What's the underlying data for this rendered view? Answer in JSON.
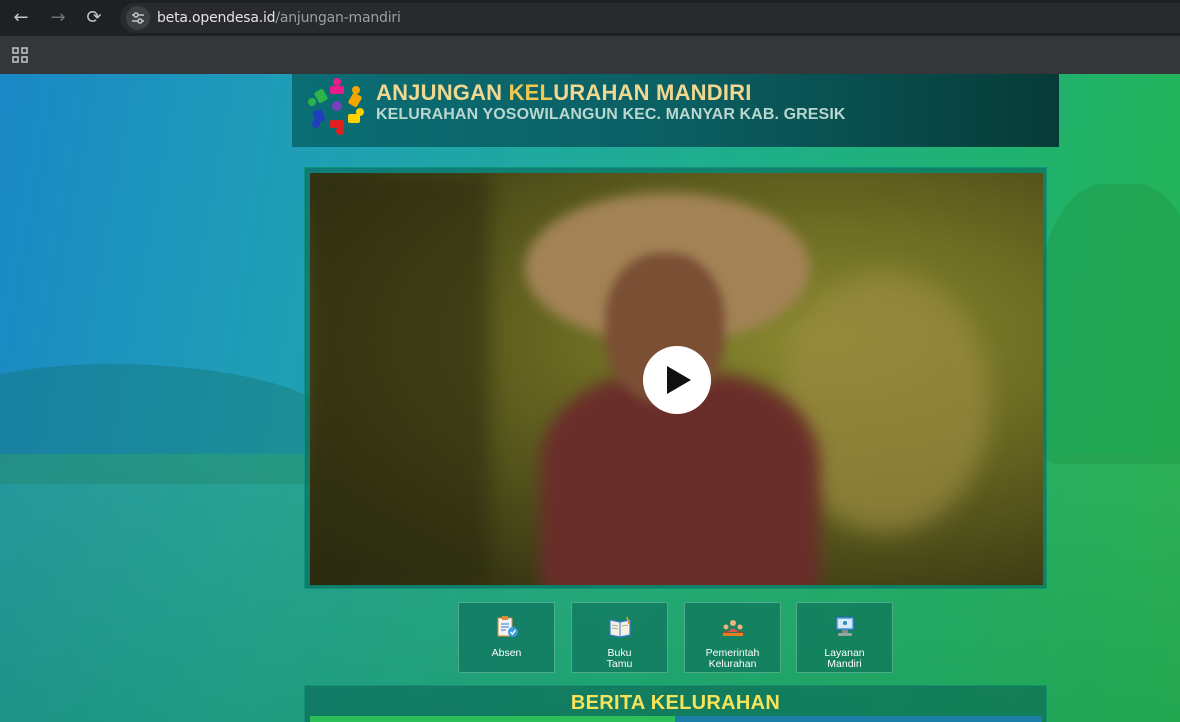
{
  "browser": {
    "url_domain": "beta.opendesa.id",
    "url_path": "/anjungan-mandiri"
  },
  "header": {
    "title_part1": "ANJUNGAN ",
    "title_part2": "KEL",
    "title_part3": "URAHAN MANDIRI",
    "subtitle": "KELURAHAN YOSOWILANGUN KEC. MANYAR KAB. GRESIK"
  },
  "video": {
    "play_icon": "play-icon"
  },
  "menu": {
    "items": [
      {
        "label": "Absen",
        "icon": "clipboard-check-icon"
      },
      {
        "label": "Buku\nTamu",
        "icon": "guest-book-icon"
      },
      {
        "label": "Pemerintah\nKelurahan",
        "icon": "government-people-icon"
      },
      {
        "label": "Layanan\nMandiri",
        "icon": "self-service-computer-icon"
      }
    ]
  },
  "news": {
    "title": "BERITA KELURAHAN"
  },
  "colors": {
    "title_gold": "#f2c94c",
    "news_title": "#f7e35a",
    "header_bg": "#0b5f63"
  }
}
